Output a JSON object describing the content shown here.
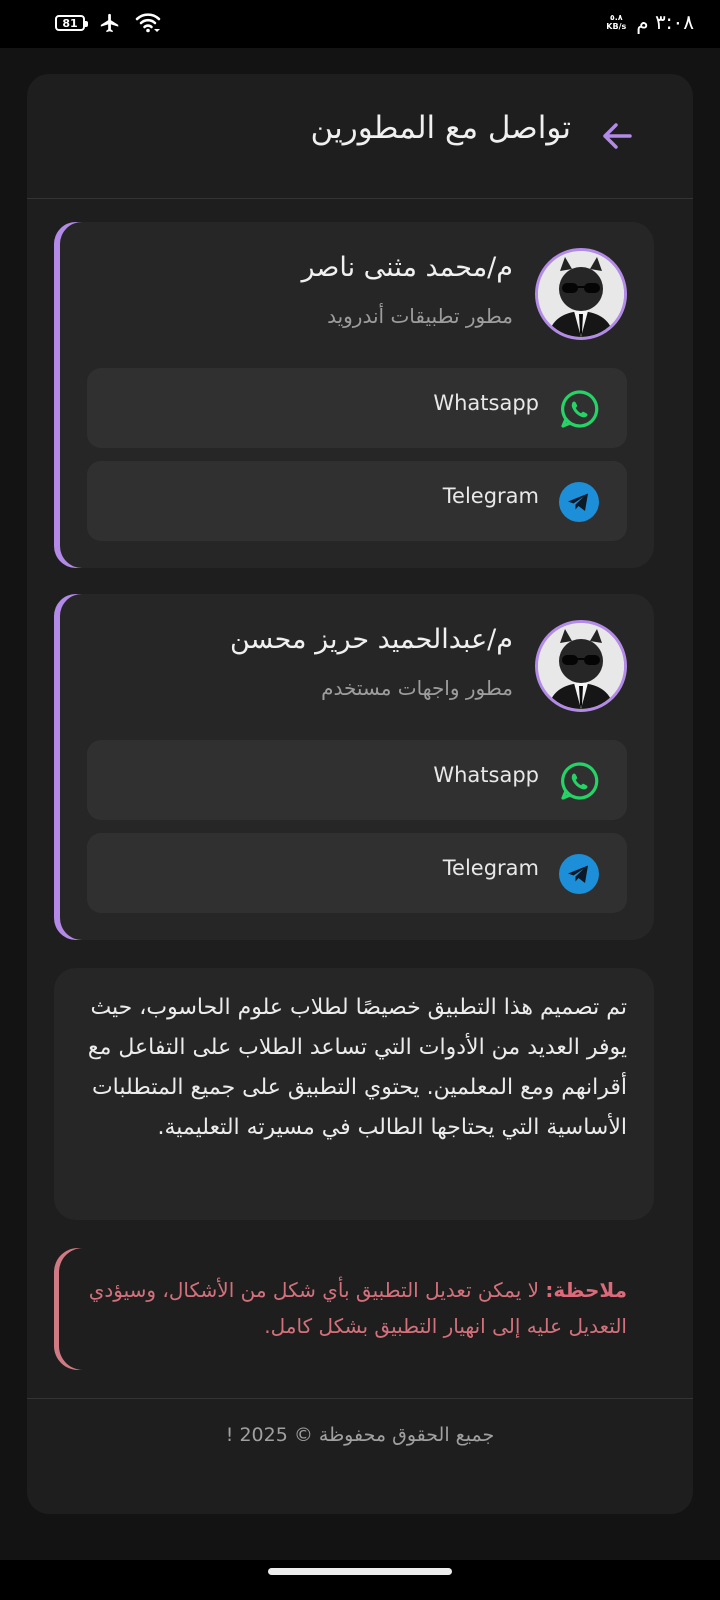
{
  "status_bar": {
    "battery": "81",
    "net_speed_value": "٥.٨",
    "net_speed_unit": "KB/s",
    "time": "٣:٠٨ م"
  },
  "header": {
    "title": "تواصل مع المطورين",
    "back_icon": "arrow-back-icon"
  },
  "developers": [
    {
      "name": "م/محمد مثنى ناصر",
      "role": "مطور تطبيقات أندرويد",
      "contacts": [
        {
          "label": "Whatsapp",
          "icon": "whatsapp-icon",
          "color": "#25d366"
        },
        {
          "label": "Telegram",
          "icon": "telegram-icon",
          "color": "#1d8fd8"
        }
      ]
    },
    {
      "name": "م/عبدالحميد حريز محسن",
      "role": "مطور واجهات مستخدم",
      "contacts": [
        {
          "label": "Whatsapp",
          "icon": "whatsapp-icon",
          "color": "#25d366"
        },
        {
          "label": "Telegram",
          "icon": "telegram-icon",
          "color": "#1d8fd8"
        }
      ]
    }
  ],
  "about": "تم تصميم هذا التطبيق خصيصًا لطلاب علوم الحاسوب، حيث يوفر العديد من الأدوات التي تساعد الطلاب على التفاعل مع أقرانهم ومع المعلمين. يحتوي التطبيق على جميع المتطلبات الأساسية التي يحتاجها الطالب في مسيرته التعليمية.",
  "note": {
    "label": "ملاحظة:",
    "text": " لا يمكن تعديل التطبيق بأي شكل من الأشكال، وسيؤدي التعديل عليه إلى انهيار التطبيق بشكل كامل."
  },
  "footer": "جميع الحقوق محفوظة © 2025 !",
  "colors": {
    "accent": "#b48ae8",
    "note": "#d4707c",
    "whatsapp": "#25d366",
    "telegram": "#1d8fd8"
  }
}
